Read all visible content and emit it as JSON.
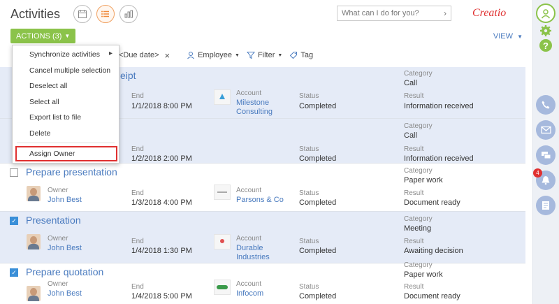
{
  "header": {
    "title": "Activities",
    "search_placeholder": "What can I do for you?",
    "logo": "Creatio",
    "actions_label": "ACTIONS (3)",
    "view_label": "VIEW"
  },
  "filters": {
    "due_date": "<Due date>",
    "employee": "Employee",
    "filter": "Filter",
    "tag": "Tag"
  },
  "menu": {
    "items": [
      "Synchronize activities",
      "Cancel multiple selection",
      "Deselect all",
      "Select all",
      "Export list to file",
      "Delete",
      "Assign Owner"
    ]
  },
  "labels": {
    "owner": "Owner",
    "end": "End",
    "account": "Account",
    "status": "Status",
    "category": "Category",
    "result": "Result"
  },
  "rows": [
    {
      "title": "eipt",
      "owner": "",
      "end": "1/1/2018 8:00 PM",
      "account": "Milestone Consulting",
      "account_line1": "Milestone",
      "account_line2": "Consulting",
      "status": "Completed",
      "category": "Call",
      "result": "Information received",
      "selected": true
    },
    {
      "title": "",
      "owner": "",
      "end": "1/2/2018 2:00 PM",
      "account": "",
      "status": "Completed",
      "category": "Call",
      "result": "Information received",
      "selected": true
    },
    {
      "title": "Prepare presentation",
      "owner": "John Best",
      "end": "1/3/2018 4:00 PM",
      "account": "Parsons & Co",
      "status": "Completed",
      "category": "Paper work",
      "result": "Document ready",
      "selected": false
    },
    {
      "title": "Presentation",
      "owner": "John Best",
      "end": "1/4/2018 1:30 PM",
      "account_line1": "Durable",
      "account_line2": "Industries",
      "status": "Completed",
      "category": "Meeting",
      "result": "Awaiting decision",
      "selected": true
    },
    {
      "title": "Prepare quotation",
      "owner": "John Best",
      "end": "1/4/2018 5:00 PM",
      "account": "Infocom",
      "status": "Completed",
      "category": "Paper work",
      "result": "Document ready",
      "selected": true
    }
  ],
  "sidebar": {
    "notification_count": "4"
  },
  "colors": {
    "accent": "#8bc34a",
    "link": "#4a7bbf",
    "selected_row": "#e5ebf7",
    "highlight": "#e03030"
  }
}
